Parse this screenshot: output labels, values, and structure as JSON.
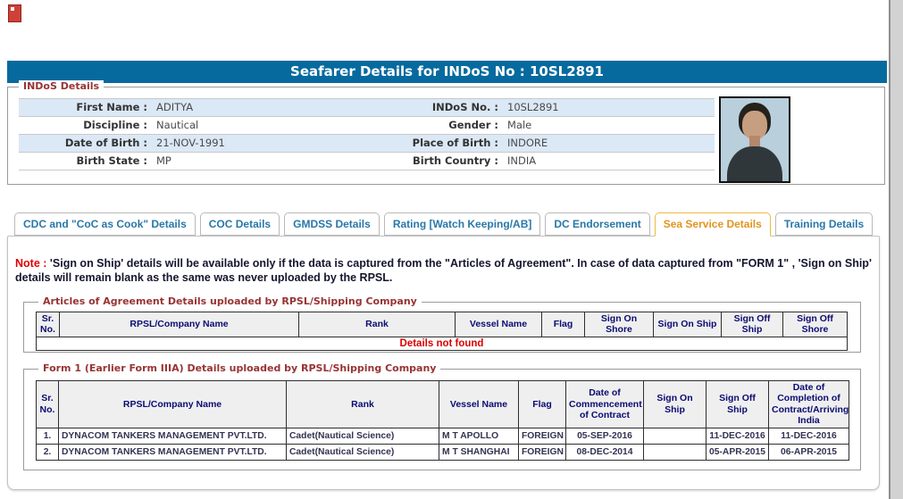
{
  "banner": {
    "title": "Seafarer Details for INDoS No : 10SL2891"
  },
  "indos_details": {
    "legend": "INDoS Details",
    "rows": [
      {
        "l1": "First Name :",
        "v1": "ADITYA",
        "l2": "INDoS No. :",
        "v2": "10SL2891"
      },
      {
        "l1": "Discipline :",
        "v1": "Nautical",
        "l2": "Gender :",
        "v2": "Male"
      },
      {
        "l1": "Date of Birth :",
        "v1": "21-NOV-1991",
        "l2": "Place of Birth :",
        "v2": "INDORE"
      },
      {
        "l1": "Birth State :",
        "v1": "MP",
        "l2": "Birth Country :",
        "v2": "INDIA"
      }
    ]
  },
  "tabs": [
    {
      "label": "CDC and \"CoC as Cook\" Details",
      "active": false
    },
    {
      "label": "COC Details",
      "active": false
    },
    {
      "label": "GMDSS Details",
      "active": false
    },
    {
      "label": "Rating [Watch Keeping/AB]",
      "active": false
    },
    {
      "label": "DC Endorsement",
      "active": false
    },
    {
      "label": "Sea Service Details",
      "active": true
    },
    {
      "label": "Training Details",
      "active": false
    }
  ],
  "note": {
    "prefix": "Note :",
    "text": "'Sign on Ship' details will be available only if the data is captured from the \"Articles of Agreement\". In case of data captured from \"FORM 1\" , 'Sign on Ship' details will remain blank as the same was never uploaded by the RPSL."
  },
  "articles_table": {
    "legend": "Articles of Agreement Details uploaded by RPSL/Shipping Company",
    "headers": [
      "Sr. No.",
      "RPSL/Company Name",
      "Rank",
      "Vessel Name",
      "Flag",
      "Sign On Shore",
      "Sign On Ship",
      "Sign Off Ship",
      "Sign Off Shore"
    ],
    "empty_message": "Details not found"
  },
  "form1_table": {
    "legend": "Form 1 (Earlier Form IIIA) Details uploaded by RPSL/Shipping Company",
    "headers": [
      "Sr. No.",
      "RPSL/Company Name",
      "Rank",
      "Vessel Name",
      "Flag",
      "Date of Commencement of Contract",
      "Sign On Ship",
      "Sign Off Ship",
      "Date of Completion of Contract/Arriving India"
    ],
    "rows": [
      [
        "1.",
        "DYNACOM TANKERS MANAGEMENT PVT.LTD.",
        "Cadet(Nautical Science)",
        "M T APOLLO",
        "FOREIGN",
        "05-SEP-2016",
        "",
        "11-DEC-2016",
        "11-DEC-2016"
      ],
      [
        "2.",
        "DYNACOM TANKERS MANAGEMENT PVT.LTD.",
        "Cadet(Nautical Science)",
        "M T SHANGHAI",
        "FOREIGN",
        "08-DEC-2014",
        "",
        "05-APR-2015",
        "06-APR-2015"
      ]
    ]
  },
  "colors": {
    "banner_bg": "#076a9e",
    "banner_text": "#ffffff",
    "legend": "#993333",
    "tab_text": "#2878a8",
    "active_tab_text": "#e2941e",
    "active_tab_border": "#efb93f",
    "note_red": "#e00000",
    "note_text": "#15152e",
    "table_header_text": "#0b0b72",
    "empty_red": "#dd0000",
    "stripe_blue": "#dbe8f6",
    "data_text": "#333352"
  }
}
